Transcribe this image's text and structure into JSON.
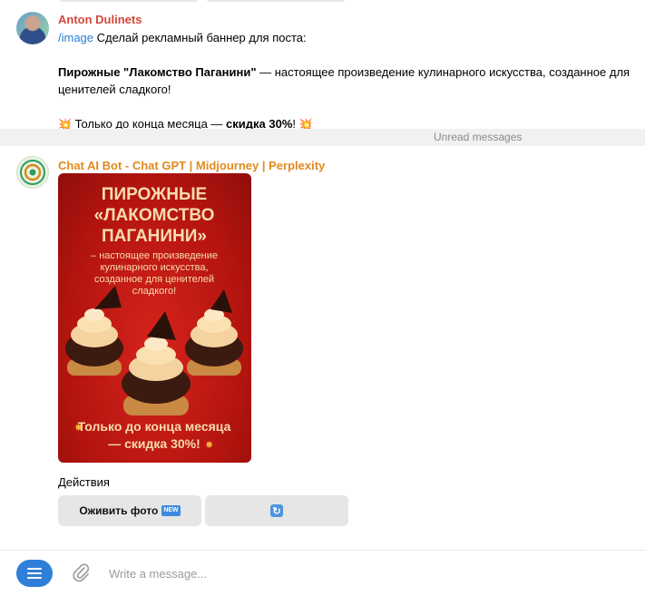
{
  "colors": {
    "user_name": "#d4473a",
    "bot_name": "#e08a1e",
    "link": "#2a7ed3",
    "accent": "#2f7fd8",
    "banner_red": "#c2180f",
    "banner_text": "#f7dcb0"
  },
  "user_message": {
    "sender": "Anton Dulinets",
    "command": "/image",
    "request": "Сделай рекламный баннер для поста:",
    "product_name": "Пирожные \"Лакомство Паганини\"",
    "product_desc": " — настоящее произведение кулинарного искусства, созданное для ценителей сладкого!",
    "promo_prefix": " Только до конца месяца — ",
    "promo_bold": "скидка 30%",
    "promo_suffix": "! ",
    "promo_icon": "💥"
  },
  "unread_label": "Unread messages",
  "bot_message": {
    "sender": "Chat AI Bot - Chat GPT | Midjourney | Perplexity",
    "banner": {
      "title_lines": [
        "ПИРОЖНЫЕ",
        "«ЛАКОМСТВО",
        "ПАГАНИНИ»"
      ],
      "body_lines": [
        "– настоящее произведение",
        "кулинарного искусства,",
        "созданное для ценителей",
        "сладкого!"
      ],
      "promo_lines": [
        "Только до конца месяца",
        "— скидка 30%!"
      ],
      "image_alt": "cupcakes-with-cream-icon"
    },
    "actions_label": "Действия",
    "buttons": {
      "animate": "Оживить фото",
      "new_badge": "NEW",
      "refresh_icon": "refresh-icon"
    }
  },
  "composer": {
    "placeholder": "Write a message..."
  }
}
